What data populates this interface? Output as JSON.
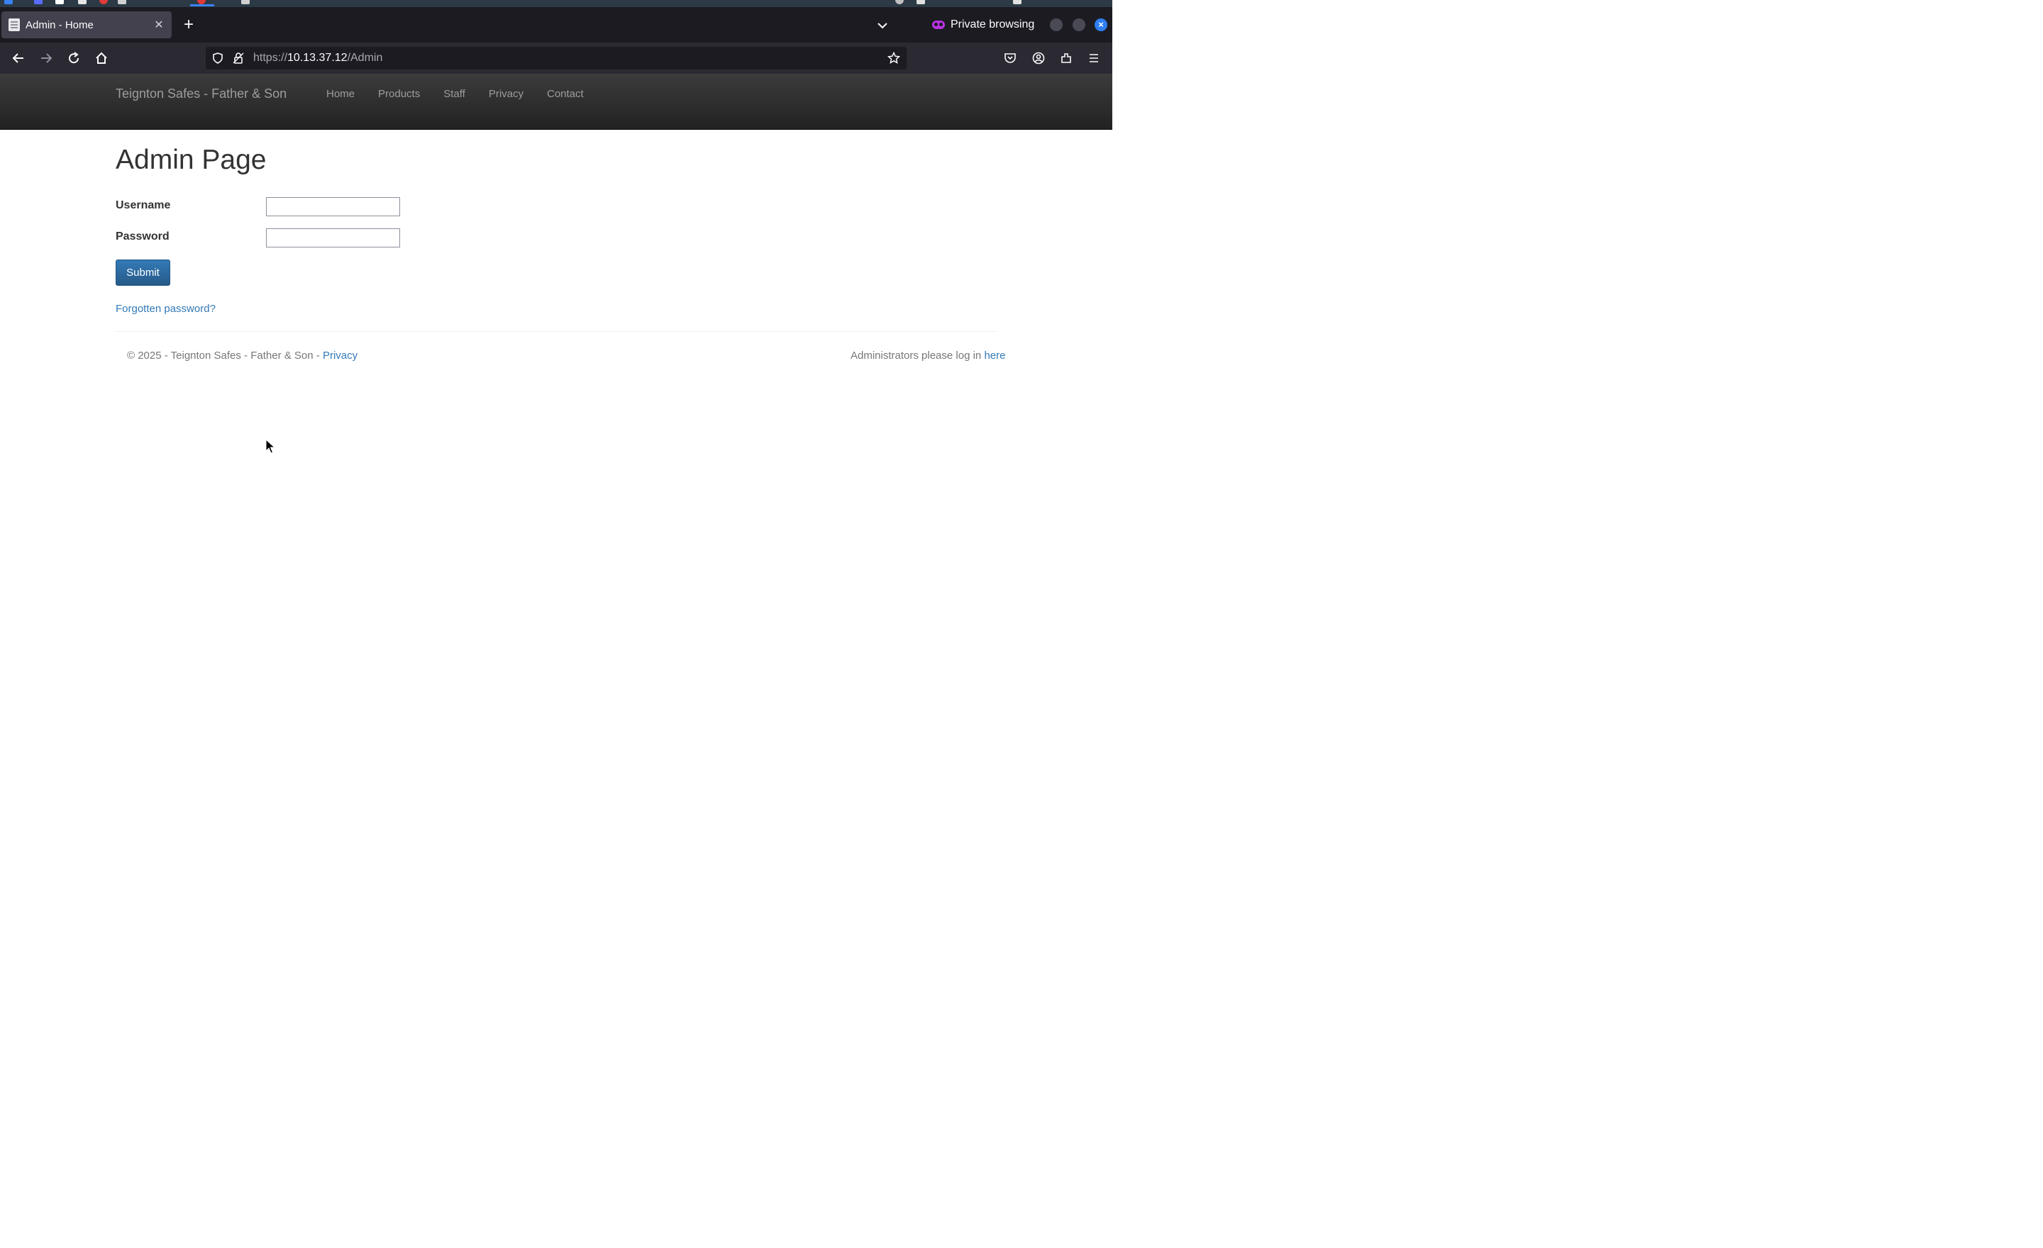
{
  "browser": {
    "tab": {
      "title": "Admin - Home",
      "close_glyph": "✕"
    },
    "new_tab_glyph": "+",
    "private_label": "Private browsing",
    "url": {
      "scheme": "https://",
      "host": "10.13.37.12",
      "path": "/Admin"
    },
    "icons": [
      "back-icon",
      "forward-icon",
      "reload-icon",
      "home-icon",
      "shield-icon",
      "lock-icon",
      "star-icon",
      "pocket-icon",
      "account-icon",
      "extensions-icon",
      "menu-icon",
      "tab-list-icon"
    ],
    "accent": "#2e7ef0"
  },
  "site": {
    "brand": "Teignton Safes - Father & Son",
    "nav": [
      "Home",
      "Products",
      "Staff",
      "Privacy",
      "Contact"
    ],
    "link_color": "#337ab7"
  },
  "page": {
    "title": "Admin Page",
    "username_label": "Username",
    "password_label": "Password",
    "username_value": "",
    "password_value": "",
    "submit_label": "Submit",
    "forgot_label": "Forgotten password?"
  },
  "footer": {
    "copyright": "© 2025 - Teignton Safes - Father & Son - ",
    "privacy_label": "Privacy",
    "admin_text": "Administrators please log in ",
    "admin_link": "here"
  }
}
